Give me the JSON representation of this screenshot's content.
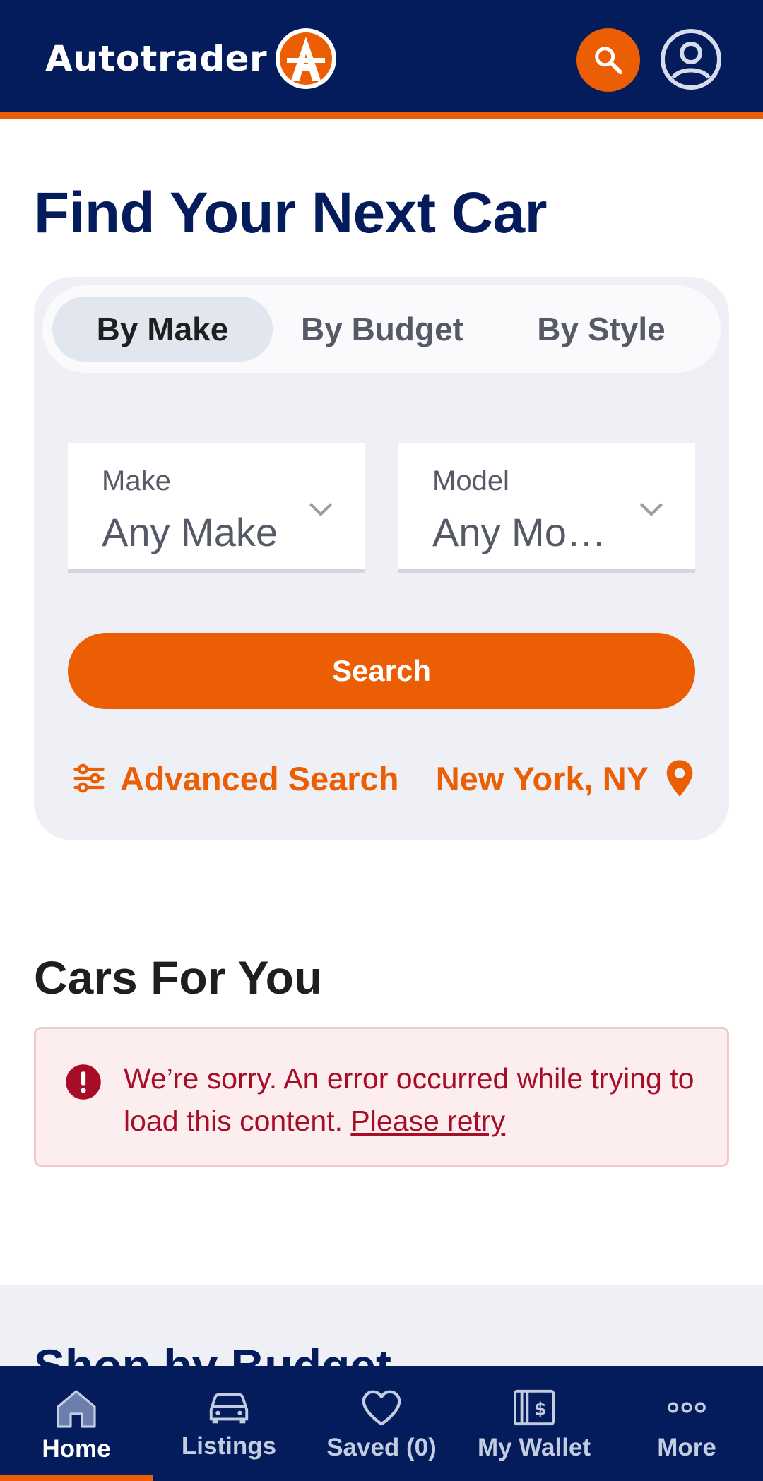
{
  "header": {
    "logo_text": "Autotrader",
    "search_icon": "search-icon",
    "account_icon": "account-icon"
  },
  "page": {
    "title": "Find Your Next Car"
  },
  "search_panel": {
    "tabs": [
      {
        "label": "By Make",
        "active": true
      },
      {
        "label": "By Budget",
        "active": false
      },
      {
        "label": "By Style",
        "active": false
      }
    ],
    "make": {
      "label": "Make",
      "value": "Any Make"
    },
    "model": {
      "label": "Model",
      "value": "Any Mo…"
    },
    "search_label": "Search",
    "advanced_label": "Advanced Search",
    "location_label": "New York, NY"
  },
  "cars_for_you": {
    "title": "Cars For You",
    "error_message": "We’re sorry. An error occurred while trying to load this content.",
    "retry_label": "Please retry"
  },
  "budget": {
    "title": "Shop by Budget"
  },
  "bottom_nav": {
    "items": [
      {
        "label": "Home",
        "icon": "home-icon",
        "active": true
      },
      {
        "label": "Listings",
        "icon": "car-icon",
        "active": false
      },
      {
        "label": "Saved (0)",
        "icon": "heart-icon",
        "active": false
      },
      {
        "label": "My Wallet",
        "icon": "wallet-icon",
        "active": false
      },
      {
        "label": "More",
        "icon": "more-dots-icon",
        "active": false
      }
    ]
  },
  "colors": {
    "navy": "#041C5C",
    "orange": "#EB5E04",
    "error_red": "#A70D27",
    "panel_bg": "#EEF0F6"
  }
}
